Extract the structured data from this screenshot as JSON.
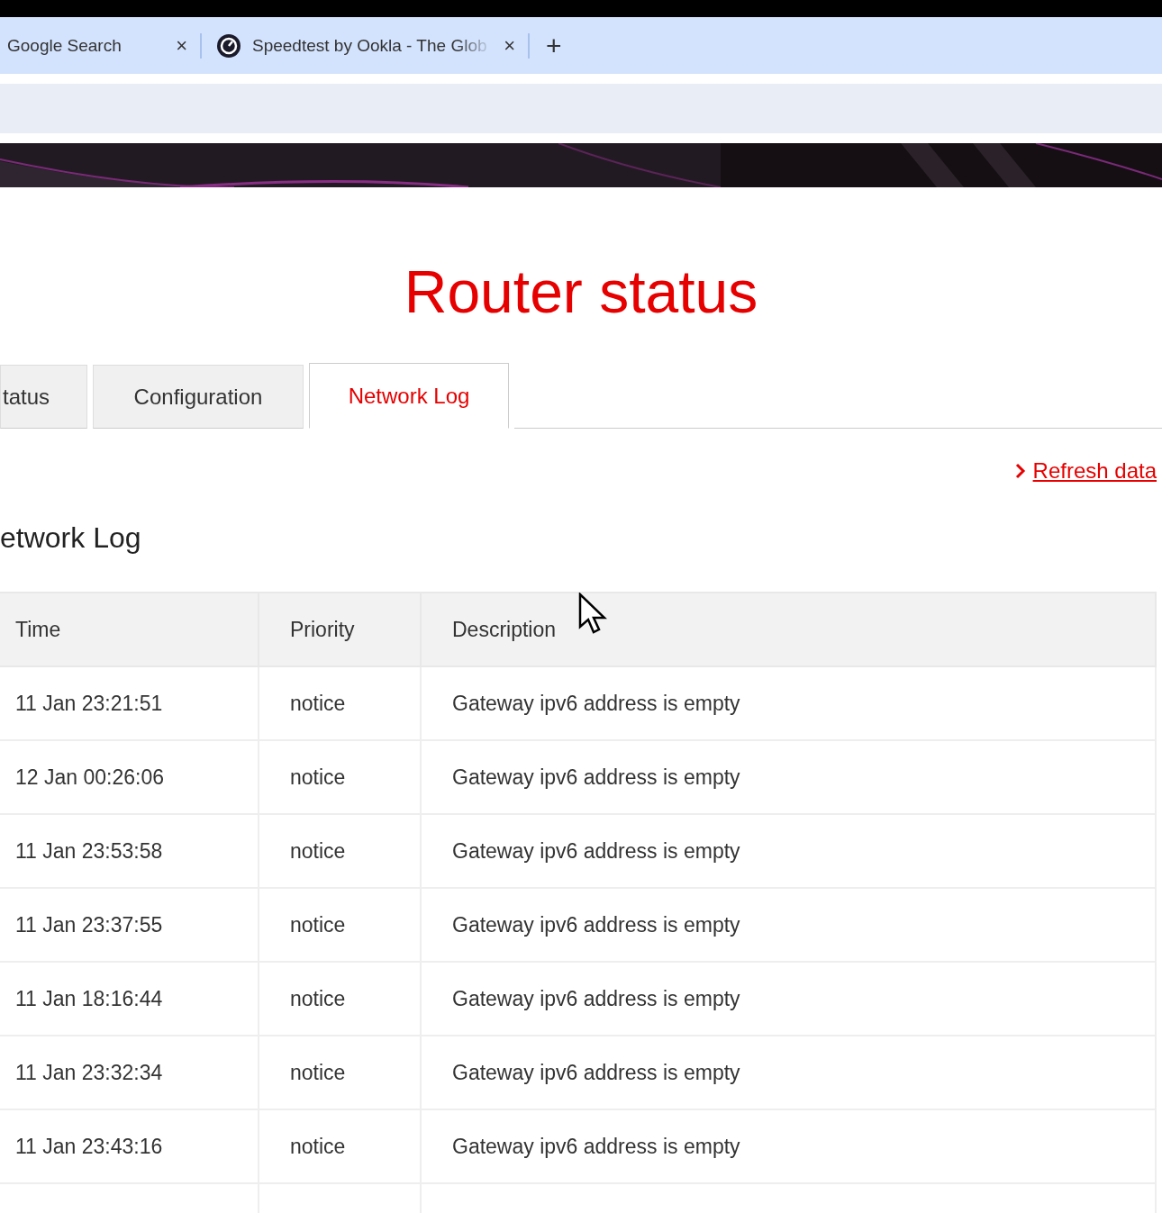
{
  "browser_tabs": [
    {
      "title": "Google Search",
      "close": "×",
      "selected": false,
      "kind": "plain"
    },
    {
      "title": "Speedtest by Ookla - The Glob",
      "close": "×",
      "selected": false,
      "kind": "favicon"
    }
  ],
  "new_tab": "+",
  "page": {
    "title": "Router status",
    "tabs": [
      {
        "label": "tatus",
        "selected": false
      },
      {
        "label": "Configuration",
        "selected": false
      },
      {
        "label": "Network Log",
        "selected": true
      }
    ],
    "refresh_link": "Refresh data",
    "heading": "etwork Log",
    "table": {
      "columns": [
        "Time",
        "Priority",
        "Description"
      ],
      "rows": [
        [
          "11 Jan 23:21:51",
          "notice",
          "Gateway ipv6 address is empty"
        ],
        [
          "12 Jan 00:26:06",
          "notice",
          "Gateway ipv6 address is empty"
        ],
        [
          "11 Jan 23:53:58",
          "notice",
          "Gateway ipv6 address is empty"
        ],
        [
          "11 Jan 23:37:55",
          "notice",
          "Gateway ipv6 address is empty"
        ],
        [
          "11 Jan 18:16:44",
          "notice",
          "Gateway ipv6 address is empty"
        ],
        [
          "11 Jan 23:32:34",
          "notice",
          "Gateway ipv6 address is empty"
        ],
        [
          "11 Jan 23:43:16",
          "notice",
          "Gateway ipv6 address is empty"
        ]
      ]
    }
  }
}
